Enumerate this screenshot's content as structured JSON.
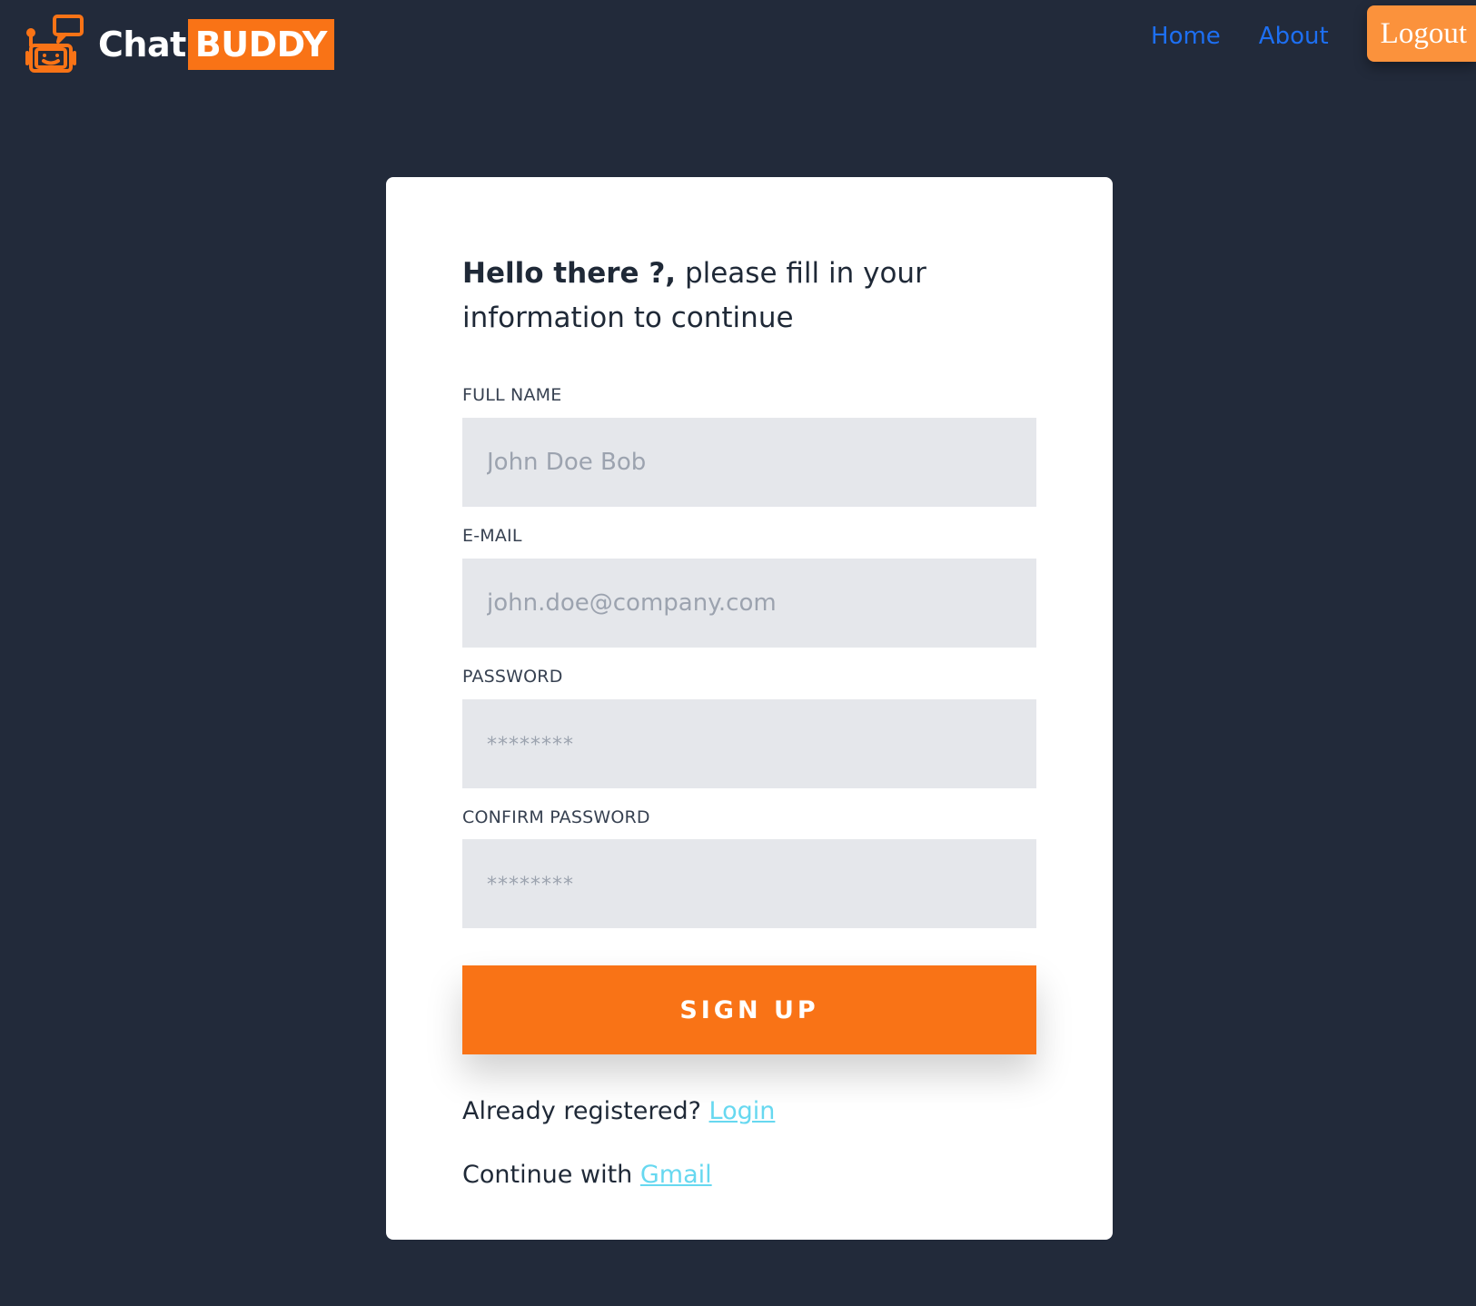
{
  "brand": {
    "name_part1": "Chat",
    "name_part2": "BUDDY",
    "logo_icon": "robot-chat-icon",
    "accent_color": "#f97316"
  },
  "nav": {
    "home_label": "Home",
    "about_label": "About",
    "logout_label": "Logout",
    "link_color": "#1d6ff2",
    "logout_color": "#fb923c"
  },
  "form": {
    "greeting_bold": "Hello there ?,",
    "greeting_rest": " please fill in your information to continue",
    "full_name": {
      "label": "FULL NAME",
      "placeholder": "John Doe Bob",
      "value": ""
    },
    "email": {
      "label": "E-MAIL",
      "placeholder": "john.doe@company.com",
      "value": ""
    },
    "password": {
      "label": "PASSWORD",
      "placeholder": "********",
      "value": ""
    },
    "confirm_password": {
      "label": "CONFIRM PASSWORD",
      "placeholder": "********",
      "value": ""
    },
    "submit_label": "SIGN UP",
    "already_registered_text": "Already registered?",
    "login_link": "Login",
    "continue_text": "Continue with",
    "gmail_link": "Gmail",
    "link_color": "#67d8f0"
  },
  "colors": {
    "background": "#222a3a",
    "card": "#ffffff",
    "input_bg": "#e5e7eb",
    "button": "#f97316"
  }
}
